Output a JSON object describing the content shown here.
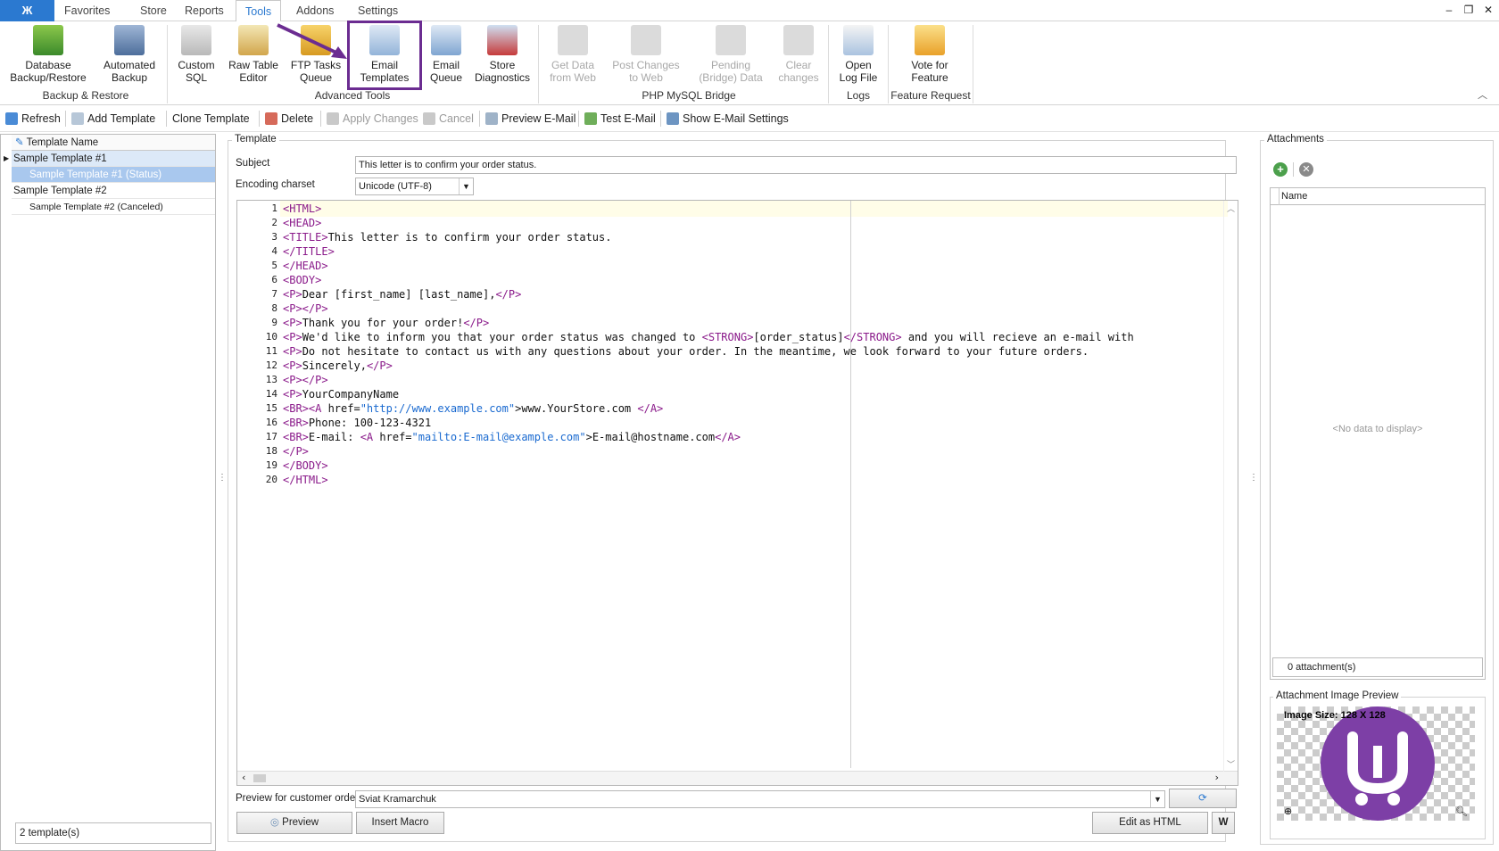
{
  "tabs": [
    "Favorites",
    "Store",
    "Reports",
    "Tools",
    "Addons",
    "Settings"
  ],
  "active_tab": "Tools",
  "ribbon": {
    "buttons": [
      {
        "l1": "Database",
        "l2": "Backup/Restore"
      },
      {
        "l1": "Automated",
        "l2": "Backup"
      },
      {
        "l1": "Custom",
        "l2": "SQL"
      },
      {
        "l1": "Raw Table",
        "l2": "Editor"
      },
      {
        "l1": "FTP Tasks",
        "l2": "Queue"
      },
      {
        "l1": "Email",
        "l2": "Templates"
      },
      {
        "l1": "Email",
        "l2": "Queue"
      },
      {
        "l1": "Store",
        "l2": "Diagnostics"
      },
      {
        "l1": "Get Data",
        "l2": "from Web"
      },
      {
        "l1": "Post Changes",
        "l2": "to Web"
      },
      {
        "l1": "Pending",
        "l2": "(Bridge) Data"
      },
      {
        "l1": "Clear",
        "l2": "changes"
      },
      {
        "l1": "Open",
        "l2": "Log File"
      },
      {
        "l1": "Vote for",
        "l2": "Feature"
      }
    ],
    "groups": [
      "Backup & Restore",
      "Advanced Tools",
      "PHP MySQL Bridge",
      "Logs",
      "Feature Request"
    ]
  },
  "toolbar": [
    "Refresh",
    "Add Template",
    "Clone Template",
    "Delete",
    "Apply Changes",
    "Cancel",
    "Preview E-Mail",
    "Test E-Mail",
    "Show E-Mail Settings"
  ],
  "tree": {
    "header": "Template Name",
    "rows": [
      "Sample Template #1",
      "Sample Template #1 (Status)",
      "Sample Template #2",
      "Sample Template #2 (Canceled)"
    ],
    "footer": "2 template(s)"
  },
  "template": {
    "group": "Template",
    "subject_label": "Subject",
    "subject": "This letter is to confirm your order status.",
    "encoding_label": "Encoding charset",
    "encoding": "Unicode (UTF-8)",
    "preview_label": "Preview for customer order",
    "preview_customer": "Sviat Kramarchuk",
    "btn_preview": "Preview",
    "btn_macro": "Insert Macro",
    "btn_edit_html": "Edit as HTML"
  },
  "code_lines": [
    "1",
    "2",
    "3",
    "4",
    "5",
    "6",
    "7",
    "8",
    "9",
    "10",
    "11",
    "12",
    "13",
    "14",
    "15",
    "16",
    "17",
    "18",
    "19",
    "20"
  ],
  "code": [
    [
      [
        "t",
        "<HTML>"
      ]
    ],
    [
      [
        "t",
        "<HEAD>"
      ]
    ],
    [
      [
        "t",
        "<TITLE>"
      ],
      [
        "p",
        "This letter is to confirm your order status."
      ]
    ],
    [
      [
        "t",
        "</TITLE>"
      ]
    ],
    [
      [
        "t",
        "</HEAD>"
      ]
    ],
    [
      [
        "t",
        "<BODY>"
      ]
    ],
    [
      [
        "t",
        "<P>"
      ],
      [
        "p",
        "Dear [first_name] [last_name],"
      ],
      [
        "t",
        "</P>"
      ]
    ],
    [
      [
        "t",
        "<P></P>"
      ]
    ],
    [
      [
        "t",
        "<P>"
      ],
      [
        "p",
        "Thank you for your order!"
      ],
      [
        "t",
        "</P>"
      ]
    ],
    [
      [
        "t",
        "<P>"
      ],
      [
        "p",
        "We'd like to inform you that your order status was changed to "
      ],
      [
        "t",
        "<STRONG>"
      ],
      [
        "p",
        "[order_status]"
      ],
      [
        "t",
        "</STRONG>"
      ],
      [
        "p",
        " and you will recieve an e-mail with"
      ]
    ],
    [
      [
        "t",
        "<P>"
      ],
      [
        "p",
        "Do not hesitate to contact us with any questions about your order. In the meantime, we look forward to your future orders."
      ]
    ],
    [
      [
        "t",
        "<P>"
      ],
      [
        "p",
        "Sincerely,"
      ],
      [
        "t",
        "</P>"
      ]
    ],
    [
      [
        "t",
        "<P></P>"
      ]
    ],
    [
      [
        "t",
        "<P>"
      ],
      [
        "p",
        "YourCompanyName"
      ]
    ],
    [
      [
        "t",
        "<BR><A "
      ],
      [
        "p",
        "href="
      ],
      [
        "s",
        "\"http://www.example.com\""
      ],
      [
        "p",
        ">www.YourStore.com "
      ],
      [
        "t",
        "</A>"
      ]
    ],
    [
      [
        "t",
        "<BR>"
      ],
      [
        "p",
        "Phone: 100-123-4321"
      ]
    ],
    [
      [
        "t",
        "<BR>"
      ],
      [
        "p",
        "E-mail: "
      ],
      [
        "t",
        "<A "
      ],
      [
        "p",
        "href="
      ],
      [
        "s",
        "\"mailto:E-mail@example.com\""
      ],
      [
        "p",
        ">E-mail@hostname.com"
      ],
      [
        "t",
        "</A>"
      ]
    ],
    [
      [
        "t",
        "</P>"
      ]
    ],
    [
      [
        "t",
        "</BODY>"
      ]
    ],
    [
      [
        "t",
        "</HTML>"
      ]
    ]
  ],
  "attachments": {
    "group": "Attachments",
    "col_name": "Name",
    "empty": "<No data to display>",
    "count": "0 attachment(s)",
    "preview_group": "Attachment Image Preview",
    "image_size": "Image Size: 128 X 128"
  },
  "colors": {
    "accent": "#2b79d0",
    "highlight": "#6b2c91",
    "tag": "#8a1a8a",
    "string": "#1a6ad0",
    "selected_row": "#a9c8ee"
  }
}
